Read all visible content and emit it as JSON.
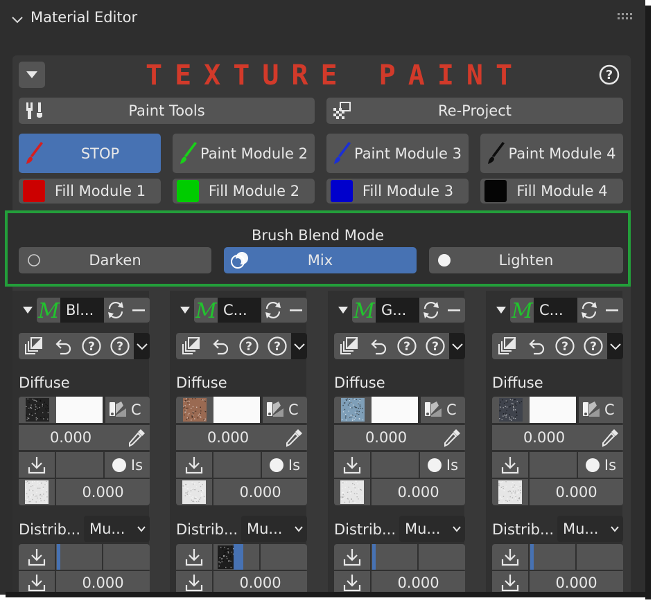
{
  "header": {
    "title": "Material Editor"
  },
  "texture_paint": {
    "title": "TEXTURE PAINT",
    "paint_tools_label": "Paint Tools",
    "reproject_label": "Re-Project",
    "paint_modules": [
      {
        "label": "STOP",
        "color": "#d61f1f",
        "active": true
      },
      {
        "label": "Paint Module 2",
        "color": "#19d119",
        "active": false
      },
      {
        "label": "Paint Module 3",
        "color": "#1a2fd6",
        "active": false
      },
      {
        "label": "Paint Module 4",
        "color": "#0d0d0d",
        "active": false
      }
    ],
    "fill_modules": [
      {
        "label": "Fill Module 1",
        "color": "#cc0000"
      },
      {
        "label": "Fill Module 2",
        "color": "#00cc00"
      },
      {
        "label": "Fill Module 3",
        "color": "#0000cc"
      },
      {
        "label": "Fill Module 4",
        "color": "#050505"
      }
    ]
  },
  "brush_blend": {
    "title": "Brush Blend Mode",
    "options": [
      {
        "label": "Darken",
        "selected": false
      },
      {
        "label": "Mix",
        "selected": true
      },
      {
        "label": "Lighten",
        "selected": false
      }
    ]
  },
  "columns": [
    {
      "name": "Bl...",
      "section": "Diffuse",
      "flag": "C",
      "value1": "0.000",
      "is_label": "Is",
      "value2": "0.000",
      "distrib_label": "Distrib...",
      "distrib_value": "Mu...",
      "value3": "0.000",
      "thumb_color": "#232323"
    },
    {
      "name": "C...",
      "section": "Diffuse",
      "flag": "C",
      "value1": "0.000",
      "is_label": "Is",
      "value2": "0.000",
      "distrib_label": "Distrib...",
      "distrib_value": "Mu...",
      "value3": "0.000",
      "thumb_color": "#9a6a52"
    },
    {
      "name": "G...",
      "section": "Diffuse",
      "flag": "C",
      "value1": "0.000",
      "is_label": "Is",
      "value2": "0.000",
      "distrib_label": "Distrib...",
      "distrib_value": "Mu...",
      "value3": "0.000",
      "thumb_color": "#7f9fb8"
    },
    {
      "name": "C...",
      "section": "Diffuse",
      "flag": "C",
      "value1": "0.000",
      "is_label": "Is",
      "value2": "0.000",
      "distrib_label": "Distrib...",
      "distrib_value": "Mu...",
      "value3": "0.000",
      "thumb_color": "#3f434c"
    }
  ],
  "colors": {
    "accent_blue": "#4772b3",
    "title_red": "#d23a2a",
    "highlight_green": "#239e3a"
  }
}
